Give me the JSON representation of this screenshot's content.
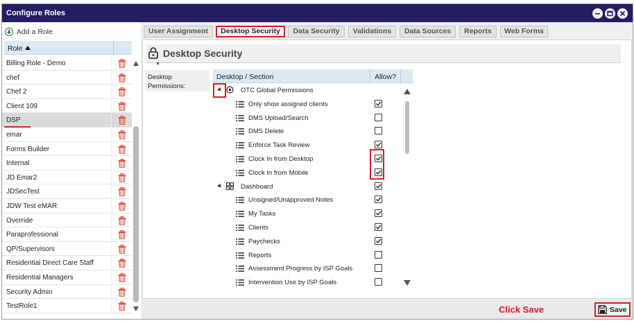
{
  "window": {
    "title": "Configure Roles"
  },
  "left": {
    "add_role": "Add a Role",
    "column_header": "Role",
    "roles": [
      {
        "name": "Billing Role - Demo"
      },
      {
        "name": "chef"
      },
      {
        "name": "Chef 2"
      },
      {
        "name": "Client 109"
      },
      {
        "name": "DSP",
        "selected": true
      },
      {
        "name": "emar"
      },
      {
        "name": "Forms Builder"
      },
      {
        "name": "Internal"
      },
      {
        "name": "JD Emar2"
      },
      {
        "name": "JDSecTest"
      },
      {
        "name": "JDW Test eMAR"
      },
      {
        "name": "Override"
      },
      {
        "name": "Paraprofessional"
      },
      {
        "name": "QP/Supervisors"
      },
      {
        "name": "Residential Direct Care Staff"
      },
      {
        "name": "Residential Managers"
      },
      {
        "name": "Security Admin"
      },
      {
        "name": "TestRole1"
      }
    ]
  },
  "tabs": [
    {
      "label": "User Assignment"
    },
    {
      "label": "Desktop Security",
      "active": true
    },
    {
      "label": "Data Security"
    },
    {
      "label": "Validations"
    },
    {
      "label": "Data Sources"
    },
    {
      "label": "Reports"
    },
    {
      "label": "Web Forms"
    }
  ],
  "section": {
    "title": "Desktop Security",
    "perm_label_1": "Desktop",
    "perm_label_2": "Permissions:"
  },
  "tree": {
    "col_section": "Desktop / Section",
    "col_allow": "Allow?",
    "rows": [
      {
        "label": "OTC Global Permissions",
        "group": true,
        "icon": "circle-target-icon",
        "checked": null
      },
      {
        "label": "Only show assigned clients",
        "checked": true
      },
      {
        "label": "DMS Upload/Search",
        "checked": false
      },
      {
        "label": "DMS Delete",
        "checked": false
      },
      {
        "label": "Enforce Task Review",
        "checked": true
      },
      {
        "label": "Clock In from Desktop",
        "checked": true
      },
      {
        "label": "Clock In from Mobile",
        "checked": true
      },
      {
        "label": "Dashboard",
        "group": true,
        "icon": "grid-icon",
        "checked": true
      },
      {
        "label": "Unsigned/Unapproved Notes",
        "checked": true
      },
      {
        "label": "My Tasks",
        "checked": true
      },
      {
        "label": "Clients",
        "checked": true
      },
      {
        "label": "Paychecks",
        "checked": true
      },
      {
        "label": "Reports",
        "checked": false
      },
      {
        "label": "Assessment Progress by ISP Goals",
        "checked": false
      },
      {
        "label": "Intervention Use by ISP Goals",
        "checked": false
      }
    ]
  },
  "footer": {
    "annotation": "Click Save",
    "save_label": "Save"
  },
  "colors": {
    "titlebar": "#241d63",
    "highlight": "#d41f1f",
    "header_blue": "#dbe9f5",
    "trash": "#e0503c"
  }
}
